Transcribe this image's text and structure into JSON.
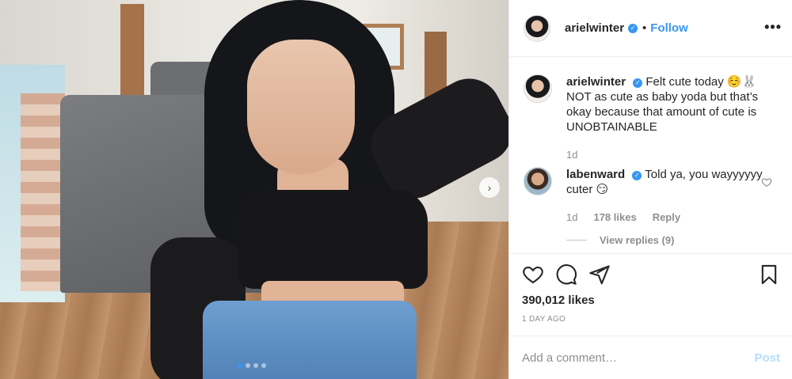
{
  "post": {
    "username": "arielwinter",
    "follow_label": "Follow",
    "separator": "•",
    "more_glyph": "•••",
    "verified_icon": "verified-badge-icon",
    "carousel": {
      "slide_count": 4,
      "active_index": 0,
      "next_glyph": "›"
    }
  },
  "caption": {
    "username": "arielwinter",
    "text": "Felt cute today ☺️🐰 NOT as cute as baby yoda but that’s okay because that amount of cute is UNOBTAINABLE",
    "age": "1d"
  },
  "comments": [
    {
      "username": "labenward",
      "text": "Told ya, you wayyyyyy cuter 😏",
      "age": "1d",
      "likes": "178 likes",
      "reply_label": "Reply",
      "view_replies": "View replies (9)"
    }
  ],
  "stats": {
    "likes": "390,012 likes",
    "age": "1 DAY AGO"
  },
  "add_comment": {
    "placeholder": "Add a comment…",
    "post_label": "Post"
  },
  "colors": {
    "accent": "#3897f0",
    "text": "#262626",
    "muted": "#8e8e8e",
    "post_disabled": "#b2dffc"
  }
}
